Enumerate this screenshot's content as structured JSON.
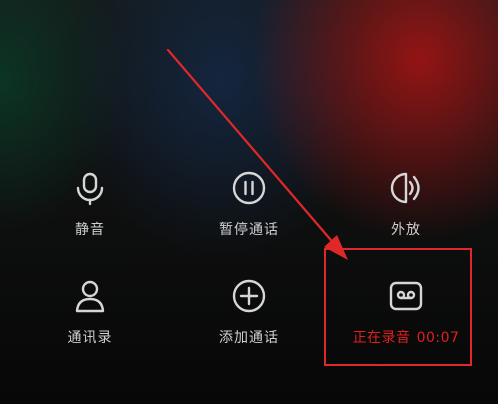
{
  "call_controls": {
    "mute": {
      "label": "静音",
      "icon": "microphone-icon"
    },
    "hold": {
      "label": "暂停通话",
      "icon": "pause-icon"
    },
    "speaker": {
      "label": "外放",
      "icon": "speaker-icon"
    },
    "contacts": {
      "label": "通讯录",
      "icon": "person-icon"
    },
    "add_call": {
      "label": "添加通话",
      "icon": "plus-icon"
    },
    "recording": {
      "label": "正在录音",
      "time": "00:07",
      "icon": "cassette-icon"
    }
  },
  "colors": {
    "label": "#cfcfcf",
    "icon": "#d6d6d6",
    "recording": "#e01f1f",
    "annotation": "#e02828"
  }
}
